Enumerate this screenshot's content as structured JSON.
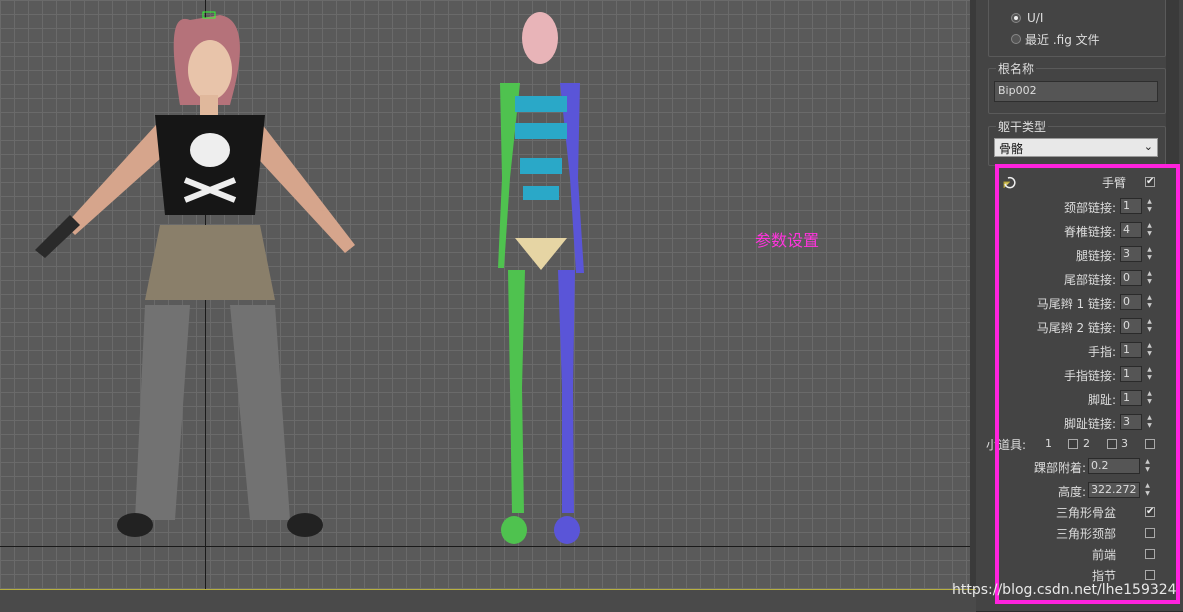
{
  "viewport": {
    "annotation": "参数设置"
  },
  "panel": {
    "top_group": {
      "radio_ui": "U/I",
      "radio_recent": "最近 .fig 文件"
    },
    "root_name": {
      "title": "根名称",
      "value": "Bip002"
    },
    "body_type": {
      "title": "躯干类型",
      "selected": "骨骼"
    },
    "params": {
      "arms_label": "手臂",
      "arms_checked": true,
      "spinners": [
        {
          "label": "颈部链接:",
          "value": "1"
        },
        {
          "label": "脊椎链接:",
          "value": "4"
        },
        {
          "label": "腿链接:",
          "value": "3"
        },
        {
          "label": "尾部链接:",
          "value": "0"
        },
        {
          "label": "马尾辫 1 链接:",
          "value": "0"
        },
        {
          "label": "马尾辫 2 链接:",
          "value": "0"
        },
        {
          "label": "手指:",
          "value": "1"
        },
        {
          "label": "手指链接:",
          "value": "1"
        },
        {
          "label": "脚趾:",
          "value": "1"
        },
        {
          "label": "脚趾链接:",
          "value": "3"
        }
      ],
      "props": {
        "label": "小道具:",
        "opt1": "1",
        "opt2": "2",
        "opt3": "3"
      },
      "ankle": {
        "label": "踝部附着:",
        "value": "0.2"
      },
      "height": {
        "label": "高度:",
        "value": "322.272"
      },
      "checks": [
        {
          "label": "三角形骨盆",
          "checked": true
        },
        {
          "label": "三角形颈部",
          "checked": false
        },
        {
          "label": "前端",
          "checked": false
        },
        {
          "label": "指节",
          "checked": false
        }
      ]
    }
  },
  "watermark": "https://blog.csdn.net/lhe159324"
}
